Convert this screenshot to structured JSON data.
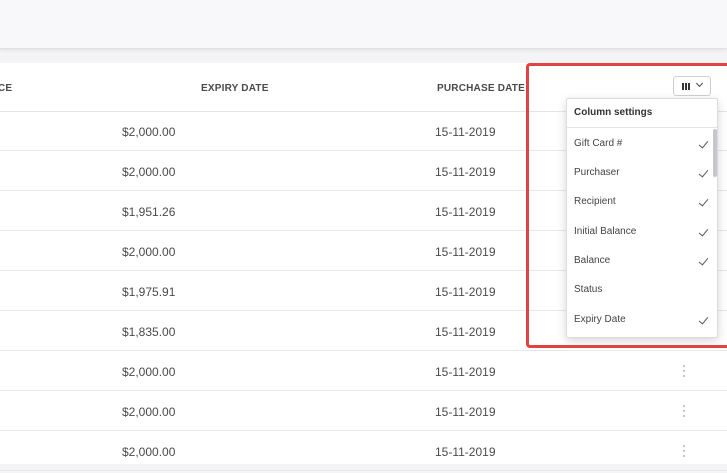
{
  "table": {
    "headers": {
      "balance": "CE",
      "expiry_date": "EXPIRY DATE",
      "purchase_date": "PURCHASE DATE"
    },
    "rows": [
      {
        "balance": "$2,000.00",
        "date": "15-11-2019"
      },
      {
        "balance": "$2,000.00",
        "date": "15-11-2019"
      },
      {
        "balance": "$1,951.26",
        "date": "15-11-2019"
      },
      {
        "balance": "$2,000.00",
        "date": "15-11-2019"
      },
      {
        "balance": "$1,975.91",
        "date": "15-11-2019"
      },
      {
        "balance": "$1,835.00",
        "date": "15-11-2019"
      },
      {
        "balance": "$2,000.00",
        "date": "15-11-2019"
      },
      {
        "balance": "$2,000.00",
        "date": "15-11-2019"
      },
      {
        "balance": "$2,000.00",
        "date": "15-11-2019"
      }
    ]
  },
  "column_settings": {
    "button_icon": "columns-icon",
    "title": "Column settings",
    "items": [
      {
        "label": "Gift Card #",
        "checked": true
      },
      {
        "label": "Purchaser",
        "checked": true
      },
      {
        "label": "Recipient",
        "checked": true
      },
      {
        "label": "Initial Balance",
        "checked": true
      },
      {
        "label": "Balance",
        "checked": true
      },
      {
        "label": "Status",
        "checked": false
      },
      {
        "label": "Expiry Date",
        "checked": true
      }
    ]
  },
  "colors": {
    "highlight": "#e04343",
    "background": "#f4f4f7"
  }
}
